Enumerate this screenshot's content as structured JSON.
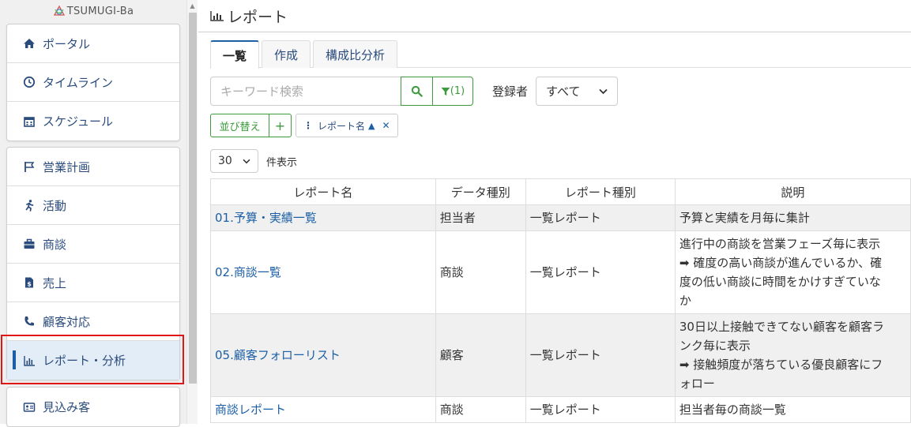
{
  "brand": {
    "name": "TSUMUGI-Ba"
  },
  "sidebar": {
    "group1": [
      {
        "label": "ポータル",
        "icon": "home-icon"
      },
      {
        "label": "タイムライン",
        "icon": "clock-icon"
      },
      {
        "label": "スケジュール",
        "icon": "calendar-icon"
      }
    ],
    "group2": [
      {
        "label": "営業計画",
        "icon": "flag-icon"
      },
      {
        "label": "活動",
        "icon": "running-icon"
      },
      {
        "label": "商談",
        "icon": "briefcase-icon"
      },
      {
        "label": "売上",
        "icon": "invoice-icon"
      },
      {
        "label": "顧客対応",
        "icon": "phone-icon"
      },
      {
        "label": "レポート・分析",
        "icon": "chart-icon",
        "active": true
      }
    ],
    "group3": [
      {
        "label": "見込み客",
        "icon": "id-card-icon"
      }
    ]
  },
  "page": {
    "title": "レポート"
  },
  "tabs": [
    {
      "label": "一覧",
      "active": true
    },
    {
      "label": "作成"
    },
    {
      "label": "構成比分析"
    }
  ],
  "search": {
    "placeholder": "キーワード検索",
    "filter_label": "(1)"
  },
  "registrant": {
    "label": "登録者",
    "value": "すべて"
  },
  "sort": {
    "button_label": "並び替え",
    "add_label": "+",
    "chip_label": "レポート名"
  },
  "pagination": {
    "per_page": "30",
    "per_page_label": "件表示"
  },
  "table": {
    "headers": [
      "レポート名",
      "データ種別",
      "レポート種別",
      "説明"
    ],
    "rows": [
      {
        "name": "01.予算・実績一覧",
        "data_type": "担当者",
        "report_type": "一覧レポート",
        "desc": [
          "予算と実績を月毎に集計"
        ]
      },
      {
        "name": "02.商談一覧",
        "data_type": "商談",
        "report_type": "一覧レポート",
        "desc": [
          "進行中の商談を営業フェーズ毎に表示",
          "➡ 確度の高い商談が進んでいるか、確",
          "度の低い商談に時間をかけすぎていな",
          "か"
        ]
      },
      {
        "name": "05.顧客フォローリスト",
        "data_type": "顧客",
        "report_type": "一覧レポート",
        "desc": [
          "30日以上接触できてない顧客を顧客ラ",
          "ンク毎に表示",
          "➡ 接触頻度が落ちている優良顧客にフ",
          "ォロー"
        ]
      },
      {
        "name": "商談レポート",
        "data_type": "商談",
        "report_type": "一覧レポート",
        "desc": [
          "担当者毎の商談一覧"
        ]
      }
    ]
  },
  "colors": {
    "accent": "#1c5fa6",
    "green": "#3c9b3c",
    "highlight": "#e01515"
  }
}
